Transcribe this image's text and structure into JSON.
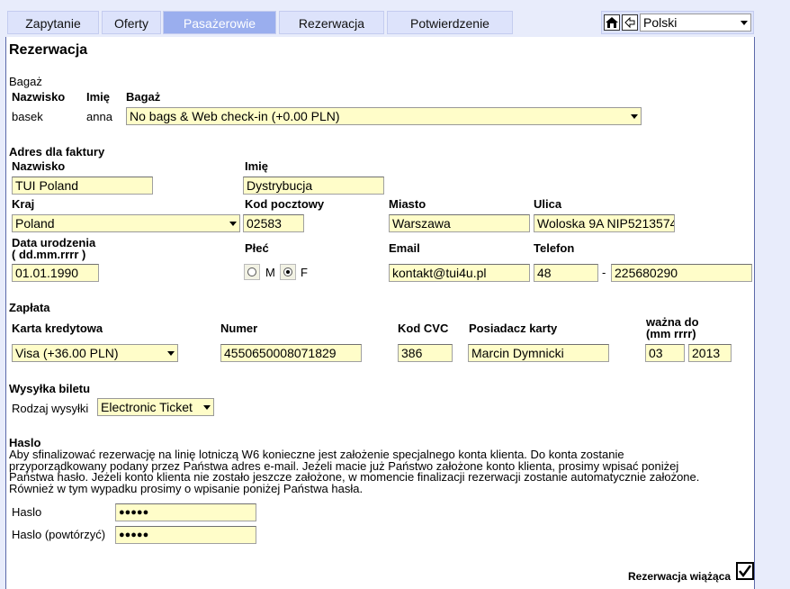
{
  "tabs": [
    "Zapytanie",
    "Oferty",
    "Pasażerowie",
    "Rezerwacja",
    "Potwierdzenie"
  ],
  "language": "Polski",
  "page_title": "Rezerwacja",
  "baggage": {
    "section": "Bagaż",
    "col_surname": "Nazwisko",
    "col_name": "Imię",
    "col_bag": "Bagaż",
    "surname": "basek",
    "name": "anna",
    "bag_option": "No bags & Web check-in (+0.00 PLN)"
  },
  "invoice": {
    "section": "Adres dla faktury",
    "surname_label": "Nazwisko",
    "surname": "TUI Poland",
    "name_label": "Imię",
    "name": "Dystrybucja",
    "country_label": "Kraj",
    "country": "Poland",
    "postcode_label": "Kod pocztowy",
    "postcode": "02583",
    "city_label": "Miasto",
    "city": "Warszawa",
    "street_label": "Ulica",
    "street": "Woloska 9A NIP5213574",
    "dob_label_1": "Data urodzenia",
    "dob_label_2": "( dd.mm.rrrr )",
    "dob": "01.01.1990",
    "gender_label": "Płeć",
    "gender_m": "M",
    "gender_f": "F",
    "email_label": "Email",
    "email": "kontakt@tui4u.pl",
    "phone_label": "Telefon",
    "phone_prefix": "48",
    "phone_dash": "-",
    "phone": "225680290"
  },
  "payment": {
    "section": "Zapłata",
    "card_label": "Karta kredytowa",
    "card": "Visa (+36.00 PLN)",
    "number_label": "Numer",
    "number": "4550650008071829",
    "cvc_label": "Kod CVC",
    "cvc": "386",
    "holder_label": "Posiadacz karty",
    "holder": "Marcin Dymnicki",
    "valid_label_1": "ważna do",
    "valid_label_2": "(mm rrrr)",
    "valid_month": "03",
    "valid_year": "2013"
  },
  "ticket": {
    "section": "Wysyłka biletu",
    "type_label": "Rodzaj wysyłki",
    "type": "Electronic Ticket"
  },
  "password": {
    "section": "Haslo",
    "info_1": "Aby sfinalizować rezerwację na linię lotniczą W6 konieczne jest założenie specjalnego konta klienta. Do konta zostanie",
    "info_2": "przyporządkowany podany przez Państwa adres e-mail. Jeżeli macie już Państwo założone konto klienta, prosimy wpisać poniżej",
    "info_3": "Państwa hasło. Jeżeli konto klienta nie zostało jeszcze założone, w momencie finalizacji rezerwacji zostanie automatycznie założone.",
    "info_4": "Również w tym wypadku prosimy o wpisanie poniżej Państwa hasła.",
    "pass_label": "Haslo",
    "pass_value": "●●●●●",
    "repeat_label": "Haslo (powtórzyć)",
    "repeat_value": "●●●●●"
  },
  "binding_label": "Rezerwacja wiążąca"
}
